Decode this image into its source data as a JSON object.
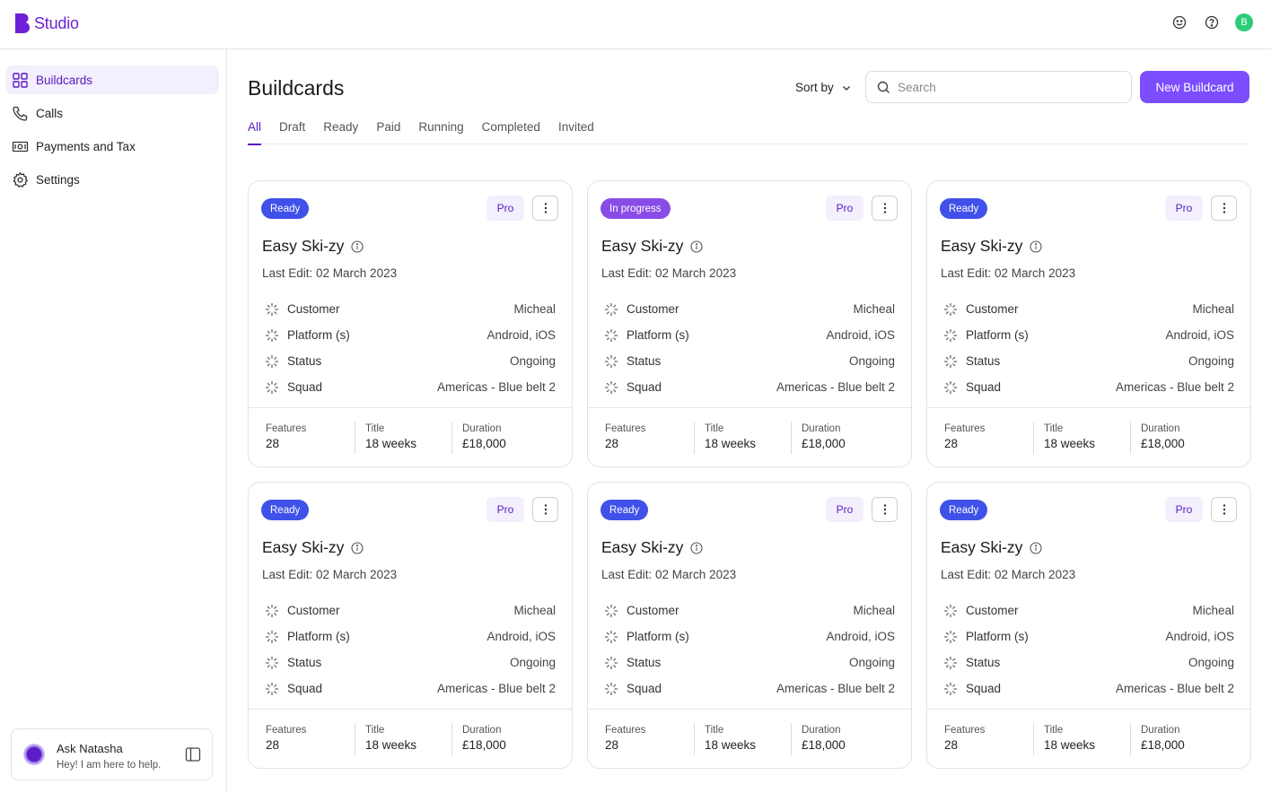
{
  "app": {
    "name": "Studio"
  },
  "topbar": {
    "avatar_initial": "B"
  },
  "sidebar": {
    "items": [
      {
        "label": "Buildcards",
        "icon": "grid-icon",
        "active": true
      },
      {
        "label": "Calls",
        "icon": "phone-icon",
        "active": false
      },
      {
        "label": "Payments and Tax",
        "icon": "banknote-icon",
        "active": false
      },
      {
        "label": "Settings",
        "icon": "gear-icon",
        "active": false
      }
    ],
    "assistant": {
      "name": "Ask Natasha",
      "subtitle": "Hey! I am here to help."
    }
  },
  "main": {
    "title": "Buildcards",
    "sort_label": "Sort by",
    "search_placeholder": "Search",
    "new_button": "New Buildcard",
    "tabs": [
      "All",
      "Draft",
      "Ready",
      "Paid",
      "Running",
      "Completed",
      "Invited"
    ],
    "active_tab": 0
  },
  "colors": {
    "accent": "#7c4dff",
    "brand": "#6c1fd6",
    "ready_badge": "#3f51e8",
    "progress_badge": "#8a4ce6"
  },
  "cards": [
    {
      "badge": "Ready",
      "plan": "Pro",
      "title": "Easy Ski-zy",
      "last_edit": "Last Edit: 02 March 2023",
      "rows": [
        {
          "label": "Customer",
          "value": "Micheal"
        },
        {
          "label": "Platform (s)",
          "value": "Android, iOS"
        },
        {
          "label": "Status",
          "value": "Ongoing"
        },
        {
          "label": "Squad",
          "value": "Americas - Blue belt 2"
        }
      ],
      "stats": [
        {
          "label": "Features",
          "value": "28"
        },
        {
          "label": "Title",
          "value": "18 weeks"
        },
        {
          "label": "Duration",
          "value": "£18,000"
        }
      ]
    },
    {
      "badge": "In progress",
      "plan": "Pro",
      "title": "Easy Ski-zy",
      "last_edit": "Last Edit: 02 March 2023",
      "rows": [
        {
          "label": "Customer",
          "value": "Micheal"
        },
        {
          "label": "Platform (s)",
          "value": "Android, iOS"
        },
        {
          "label": "Status",
          "value": "Ongoing"
        },
        {
          "label": "Squad",
          "value": "Americas - Blue belt 2"
        }
      ],
      "stats": [
        {
          "label": "Features",
          "value": "28"
        },
        {
          "label": "Title",
          "value": "18 weeks"
        },
        {
          "label": "Duration",
          "value": "£18,000"
        }
      ]
    },
    {
      "badge": "Ready",
      "plan": "Pro",
      "title": "Easy Ski-zy",
      "last_edit": "Last Edit: 02 March 2023",
      "rows": [
        {
          "label": "Customer",
          "value": "Micheal"
        },
        {
          "label": "Platform (s)",
          "value": "Android, iOS"
        },
        {
          "label": "Status",
          "value": "Ongoing"
        },
        {
          "label": "Squad",
          "value": "Americas - Blue belt 2"
        }
      ],
      "stats": [
        {
          "label": "Features",
          "value": "28"
        },
        {
          "label": "Title",
          "value": "18 weeks"
        },
        {
          "label": "Duration",
          "value": "£18,000"
        }
      ]
    },
    {
      "badge": "Ready",
      "plan": "Pro",
      "title": "Easy Ski-zy",
      "last_edit": "Last Edit: 02 March 2023",
      "rows": [
        {
          "label": "Customer",
          "value": "Micheal"
        },
        {
          "label": "Platform (s)",
          "value": "Android, iOS"
        },
        {
          "label": "Status",
          "value": "Ongoing"
        },
        {
          "label": "Squad",
          "value": "Americas - Blue belt 2"
        }
      ],
      "stats": [
        {
          "label": "Features",
          "value": "28"
        },
        {
          "label": "Title",
          "value": "18 weeks"
        },
        {
          "label": "Duration",
          "value": "£18,000"
        }
      ]
    },
    {
      "badge": "Ready",
      "plan": "Pro",
      "title": "Easy Ski-zy",
      "last_edit": "Last Edit: 02 March 2023",
      "rows": [
        {
          "label": "Customer",
          "value": "Micheal"
        },
        {
          "label": "Platform (s)",
          "value": "Android, iOS"
        },
        {
          "label": "Status",
          "value": "Ongoing"
        },
        {
          "label": "Squad",
          "value": "Americas - Blue belt 2"
        }
      ],
      "stats": [
        {
          "label": "Features",
          "value": "28"
        },
        {
          "label": "Title",
          "value": "18 weeks"
        },
        {
          "label": "Duration",
          "value": "£18,000"
        }
      ]
    },
    {
      "badge": "Ready",
      "plan": "Pro",
      "title": "Easy Ski-zy",
      "last_edit": "Last Edit: 02 March 2023",
      "rows": [
        {
          "label": "Customer",
          "value": "Micheal"
        },
        {
          "label": "Platform (s)",
          "value": "Android, iOS"
        },
        {
          "label": "Status",
          "value": "Ongoing"
        },
        {
          "label": "Squad",
          "value": "Americas - Blue belt 2"
        }
      ],
      "stats": [
        {
          "label": "Features",
          "value": "28"
        },
        {
          "label": "Title",
          "value": "18 weeks"
        },
        {
          "label": "Duration",
          "value": "£18,000"
        }
      ]
    }
  ]
}
